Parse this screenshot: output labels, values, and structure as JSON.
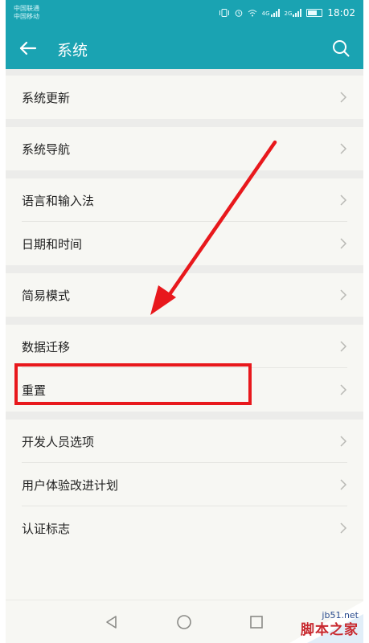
{
  "statusbar": {
    "carrier1": "中国联通",
    "carrier2": "中国移动",
    "net1": "4G",
    "net2": "2G",
    "time": "18:02"
  },
  "appbar": {
    "title": "系统",
    "back_icon": "arrow-left-icon",
    "search_icon": "search-icon"
  },
  "items": [
    {
      "label": "系统更新"
    },
    {
      "label": "系统导航"
    },
    {
      "label": "语言和输入法"
    },
    {
      "label": "日期和时间"
    },
    {
      "label": "简易模式"
    },
    {
      "label": "数据迁移"
    },
    {
      "label": "重置"
    },
    {
      "label": "开发人员选项"
    },
    {
      "label": "用户体验改进计划"
    },
    {
      "label": "认证标志"
    }
  ],
  "annotation": {
    "color": "#e8181c"
  },
  "navbar": {
    "back_icon": "triangle-back-icon",
    "home_icon": "circle-home-icon",
    "recent_icon": "square-recent-icon"
  },
  "watermark": {
    "url": "jb51.net",
    "name": "脚本之家"
  },
  "colors": {
    "accent": "#1aa3b2",
    "background": "#f7f7f3"
  }
}
